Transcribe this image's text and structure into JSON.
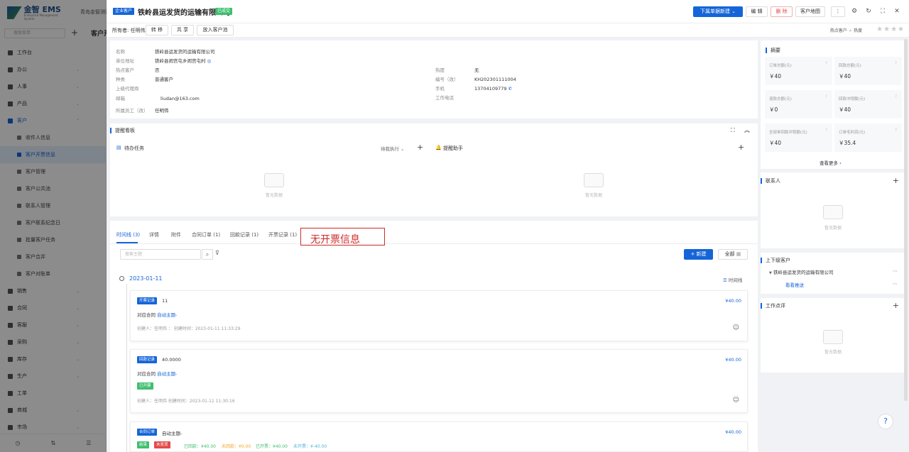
{
  "sidebar": {
    "brand": "金智 EMS",
    "brand_sub": "Enterprise Management System",
    "org": "青岛金智测试",
    "search_placeholder": "搜索菜单",
    "items": [
      {
        "label": "工作台",
        "type": "top"
      },
      {
        "label": "办公",
        "type": "top",
        "chevron": "⌄"
      },
      {
        "label": "人事",
        "type": "top",
        "chevron": "⌄"
      },
      {
        "label": "产品",
        "type": "top",
        "chevron": "⌄"
      },
      {
        "label": "客户",
        "type": "active-parent",
        "chevron": "⌃"
      },
      {
        "label": "收件人信息",
        "type": "sub"
      },
      {
        "label": "客户开票信息",
        "type": "sub-active"
      },
      {
        "label": "客户管理",
        "type": "sub"
      },
      {
        "label": "客户公共池",
        "type": "sub"
      },
      {
        "label": "联系人管理",
        "type": "sub"
      },
      {
        "label": "客户联系纪念日",
        "type": "sub"
      },
      {
        "label": "批量客户任务",
        "type": "sub"
      },
      {
        "label": "客户合并",
        "type": "sub"
      },
      {
        "label": "客户对账单",
        "type": "sub"
      },
      {
        "label": "销售",
        "type": "top",
        "chevron": "⌄"
      },
      {
        "label": "合同",
        "type": "top",
        "chevron": "⌄"
      },
      {
        "label": "客服",
        "type": "top",
        "chevron": "⌄"
      },
      {
        "label": "采购",
        "type": "top",
        "chevron": "⌄"
      },
      {
        "label": "库存",
        "type": "top",
        "chevron": "⌄"
      },
      {
        "label": "生产",
        "type": "top",
        "chevron": "⌄"
      },
      {
        "label": "工单",
        "type": "top"
      },
      {
        "label": "商城",
        "type": "top",
        "chevron": "⌄"
      },
      {
        "label": "市场",
        "type": "top",
        "chevron": "⌄"
      }
    ],
    "bottom_icons": [
      "◷",
      "⇅",
      "☰"
    ]
  },
  "background_page": {
    "title": "客户开"
  },
  "drawer": {
    "type_tag": "企业客户",
    "title": "铁岭县运发货的运输有限公司",
    "status_tag": "已成交",
    "new_doc_button": "下属单据新建 ⌄",
    "edit_button": "编 辑",
    "delete_button": "删 除",
    "map_button": "客户地图",
    "more_button": "⋮",
    "owner_label": "所有者: 任明伟",
    "transfer_button": "转 移",
    "share_button": "共 享",
    "pool_button": "放入客户池",
    "hot_label": "热点客户",
    "heat_label": "热度",
    "stars": "★★★★"
  },
  "info": {
    "name_k": "名称",
    "name_v": "铁岭县运发货的运输有限公司",
    "addr_k": "单位地址",
    "addr_v": "铁岭县闹宫屯乡闹宫屯村",
    "hot_k": "热点客户",
    "hot_v": "否",
    "heat_k": "热度",
    "heat_v": "无",
    "kind_k": "种类",
    "kind_v": "普通客户",
    "code_k": "编号（改）",
    "code_v": "KH202301111004",
    "agent_k": "上级代理商",
    "agent_v": "",
    "phone_k": "手机",
    "phone_v": "13704109779",
    "email_k": "邮箱",
    "email_v": "liudan@163.com",
    "workphone_k": "工作电话",
    "workphone_v": "",
    "staff_k": "所属员工（改）",
    "staff_v": "任明伟"
  },
  "remind": {
    "title": "提醒看板",
    "todo_title": "待办任务",
    "todo_filter": "待我执行 ⌄",
    "assist_title": "提醒助手",
    "empty": "暂无数据"
  },
  "tabs": {
    "items": [
      "时间线 (3)",
      "详情",
      "附件",
      "合同订单 (1)",
      "回款记录 (1)",
      "开票记录 (1)"
    ],
    "annotation": "无开票信息",
    "search_placeholder": "搜索主题",
    "new_button": "+ 新建",
    "all_button": "全部",
    "timeline_label": "时间线"
  },
  "timeline": {
    "date": "2023-01-11",
    "records": [
      {
        "tag": "开票记录",
        "title": "11",
        "contract_label": "对应合同",
        "contract_link": "自动主题-",
        "meta": "创建人：任明伟    ：   创建时间：2023-01-11 11:33:29",
        "amount": "¥40.00"
      },
      {
        "tag": "回款记录",
        "title": "40.0000",
        "contract_label": "对应合同",
        "contract_link": "自动主题-",
        "status": "已开票",
        "meta": "创建人：任明伟    创建时间：2023-01-11 11:30:16",
        "amount": "¥40.00"
      },
      {
        "tag": "合同订单",
        "title": "自动主题-",
        "tag2": "结束",
        "tag3": "未发货",
        "received": "已回款：¥40.00",
        "unreceived": "未回款：¥0.00",
        "invoiced": "已开票：¥40.00",
        "uninvoiced": "未开票：¥-40.00",
        "amount": "¥40.00"
      }
    ]
  },
  "summary": {
    "title": "摘要",
    "stats": [
      {
        "label": "订单总额(元)",
        "value": "￥40"
      },
      {
        "label": "回款总额(元)",
        "value": "￥40"
      },
      {
        "label": "退款总额(元)",
        "value": "￥0"
      },
      {
        "label": "回款冲销额(元)",
        "value": "￥40"
      },
      {
        "label": "全部单回款冲销额(元)",
        "value": "￥40"
      },
      {
        "label": "订单毛利润(元)",
        "value": "￥35.4"
      }
    ],
    "more": "查看更多 ›"
  },
  "contacts": {
    "title": "联系人",
    "empty": "暂无数据"
  },
  "parent": {
    "title": "上下级客户",
    "company": "铁岭县运发货的运输有限公司",
    "view": "看看推送"
  },
  "review": {
    "title": "工作点评",
    "empty": "暂无数据"
  }
}
